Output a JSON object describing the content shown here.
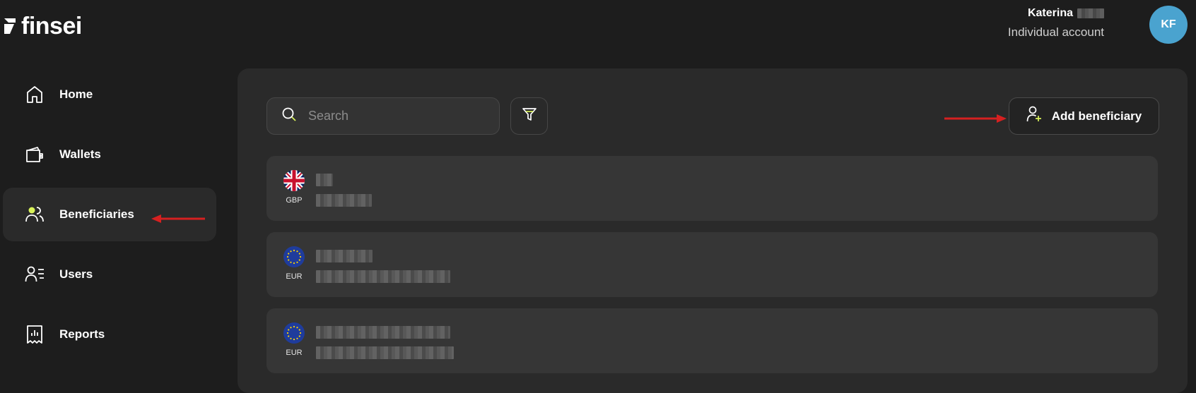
{
  "brand": {
    "name": "finsei"
  },
  "user": {
    "first_name": "Katerina",
    "account_type": "Individual account",
    "initials": "KF",
    "avatar_color": "#4aa3cf"
  },
  "sidebar": {
    "items": [
      {
        "label": "Home",
        "icon": "home-icon",
        "active": false
      },
      {
        "label": "Wallets",
        "icon": "wallet-icon",
        "active": false
      },
      {
        "label": "Beneficiaries",
        "icon": "beneficiaries-icon",
        "active": true
      },
      {
        "label": "Users",
        "icon": "users-icon",
        "active": false
      },
      {
        "label": "Reports",
        "icon": "reports-icon",
        "active": false
      }
    ]
  },
  "toolbar": {
    "search_placeholder": "Search",
    "filter_icon": "filter-icon",
    "add_label": "Add beneficiary",
    "add_icon": "add-user-icon"
  },
  "beneficiaries": [
    {
      "currency": "GBP",
      "flag": "uk-flag-icon"
    },
    {
      "currency": "EUR",
      "flag": "eu-flag-icon"
    },
    {
      "currency": "EUR",
      "flag": "eu-flag-icon"
    }
  ],
  "colors": {
    "accent": "#d9f25a",
    "annotation_arrow": "#d62020"
  }
}
